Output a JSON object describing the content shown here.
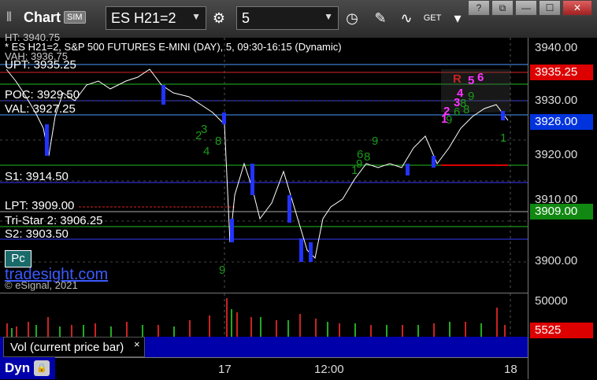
{
  "toolbar": {
    "grip": "⦀",
    "title": "Chart",
    "badge": "SIM",
    "symbol": "ES H21=2",
    "interval": "5"
  },
  "chart": {
    "header": "* ES H21=2, S&P 500 FUTURES E-MINI (DAY), 5, 09:30-16:15 (Dynamic)",
    "ht_label": "HT: 3940.75",
    "vah_label": "VAH: 3936.75",
    "upt_label": "UPT: 3935.25",
    "poc_label": "POC: 3929.50",
    "val_label": "VAL: 3927.25",
    "s1_label": "S1: 3914.50",
    "lpt_label": "LPT: 3909.00",
    "tristar_label": "Tri-Star 2: 3906.25",
    "s2_label": "S2: 3903.50",
    "pc_label": "Pc",
    "brand": "tradesight.com",
    "copyright": "© eSignal, 2021"
  },
  "price_axis": {
    "ticks": [
      "3940.00",
      "3930.00",
      "3920.00",
      "3910.00",
      "3900.00"
    ],
    "tag_red": "3935.25",
    "tag_blue": "3926.00",
    "tag_green": "3909.00",
    "colors": {
      "red": "#dd0000",
      "blue": "#0033dd",
      "green": "#118811"
    }
  },
  "volume": {
    "tick": "50000",
    "tag": "5525",
    "label": "Vol (current price bar)",
    "close_x": "×"
  },
  "time_axis": {
    "labels": [
      "17",
      "12:00",
      "18"
    ]
  },
  "status": {
    "dyn": "Dyn"
  },
  "sequential": {
    "greens": [
      "9",
      "9",
      "8",
      "2",
      "3",
      "4",
      "8",
      "9",
      "1",
      "6",
      "8",
      "9",
      "6",
      "8",
      "9",
      "1"
    ],
    "magenta": [
      "1",
      "2",
      "3",
      "4",
      "5",
      "6"
    ],
    "red_r": "R"
  }
}
